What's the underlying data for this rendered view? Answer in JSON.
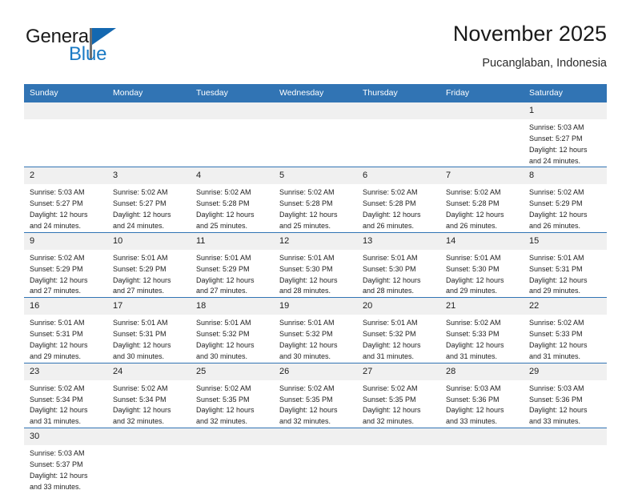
{
  "brand": {
    "name_part1": "General",
    "name_part2": "Blue",
    "logo_icon": "flag-triangle-icon",
    "accent_color": "#1a7ac4"
  },
  "header": {
    "title": "November 2025",
    "subtitle": "Pucanglaban, Indonesia"
  },
  "colors": {
    "header_blue": "#3174b4",
    "daynum_band": "#f0f0f0",
    "row_rule": "#3174b4",
    "text": "#1d1d1d"
  },
  "weekdays": [
    "Sunday",
    "Monday",
    "Tuesday",
    "Wednesday",
    "Thursday",
    "Friday",
    "Saturday"
  ],
  "weeks": [
    [
      {
        "day": "",
        "blank": true,
        "sunrise": "",
        "sunset": "",
        "daylight_line1": "",
        "daylight_line2": ""
      },
      {
        "day": "",
        "blank": true,
        "sunrise": "",
        "sunset": "",
        "daylight_line1": "",
        "daylight_line2": ""
      },
      {
        "day": "",
        "blank": true,
        "sunrise": "",
        "sunset": "",
        "daylight_line1": "",
        "daylight_line2": ""
      },
      {
        "day": "",
        "blank": true,
        "sunrise": "",
        "sunset": "",
        "daylight_line1": "",
        "daylight_line2": ""
      },
      {
        "day": "",
        "blank": true,
        "sunrise": "",
        "sunset": "",
        "daylight_line1": "",
        "daylight_line2": ""
      },
      {
        "day": "",
        "blank": true,
        "sunrise": "",
        "sunset": "",
        "daylight_line1": "",
        "daylight_line2": ""
      },
      {
        "day": "1",
        "blank": false,
        "sunrise": "Sunrise: 5:03 AM",
        "sunset": "Sunset: 5:27 PM",
        "daylight_line1": "Daylight: 12 hours",
        "daylight_line2": "and 24 minutes."
      }
    ],
    [
      {
        "day": "2",
        "blank": false,
        "sunrise": "Sunrise: 5:03 AM",
        "sunset": "Sunset: 5:27 PM",
        "daylight_line1": "Daylight: 12 hours",
        "daylight_line2": "and 24 minutes."
      },
      {
        "day": "3",
        "blank": false,
        "sunrise": "Sunrise: 5:02 AM",
        "sunset": "Sunset: 5:27 PM",
        "daylight_line1": "Daylight: 12 hours",
        "daylight_line2": "and 24 minutes."
      },
      {
        "day": "4",
        "blank": false,
        "sunrise": "Sunrise: 5:02 AM",
        "sunset": "Sunset: 5:28 PM",
        "daylight_line1": "Daylight: 12 hours",
        "daylight_line2": "and 25 minutes."
      },
      {
        "day": "5",
        "blank": false,
        "sunrise": "Sunrise: 5:02 AM",
        "sunset": "Sunset: 5:28 PM",
        "daylight_line1": "Daylight: 12 hours",
        "daylight_line2": "and 25 minutes."
      },
      {
        "day": "6",
        "blank": false,
        "sunrise": "Sunrise: 5:02 AM",
        "sunset": "Sunset: 5:28 PM",
        "daylight_line1": "Daylight: 12 hours",
        "daylight_line2": "and 26 minutes."
      },
      {
        "day": "7",
        "blank": false,
        "sunrise": "Sunrise: 5:02 AM",
        "sunset": "Sunset: 5:28 PM",
        "daylight_line1": "Daylight: 12 hours",
        "daylight_line2": "and 26 minutes."
      },
      {
        "day": "8",
        "blank": false,
        "sunrise": "Sunrise: 5:02 AM",
        "sunset": "Sunset: 5:29 PM",
        "daylight_line1": "Daylight: 12 hours",
        "daylight_line2": "and 26 minutes."
      }
    ],
    [
      {
        "day": "9",
        "blank": false,
        "sunrise": "Sunrise: 5:02 AM",
        "sunset": "Sunset: 5:29 PM",
        "daylight_line1": "Daylight: 12 hours",
        "daylight_line2": "and 27 minutes."
      },
      {
        "day": "10",
        "blank": false,
        "sunrise": "Sunrise: 5:01 AM",
        "sunset": "Sunset: 5:29 PM",
        "daylight_line1": "Daylight: 12 hours",
        "daylight_line2": "and 27 minutes."
      },
      {
        "day": "11",
        "blank": false,
        "sunrise": "Sunrise: 5:01 AM",
        "sunset": "Sunset: 5:29 PM",
        "daylight_line1": "Daylight: 12 hours",
        "daylight_line2": "and 27 minutes."
      },
      {
        "day": "12",
        "blank": false,
        "sunrise": "Sunrise: 5:01 AM",
        "sunset": "Sunset: 5:30 PM",
        "daylight_line1": "Daylight: 12 hours",
        "daylight_line2": "and 28 minutes."
      },
      {
        "day": "13",
        "blank": false,
        "sunrise": "Sunrise: 5:01 AM",
        "sunset": "Sunset: 5:30 PM",
        "daylight_line1": "Daylight: 12 hours",
        "daylight_line2": "and 28 minutes."
      },
      {
        "day": "14",
        "blank": false,
        "sunrise": "Sunrise: 5:01 AM",
        "sunset": "Sunset: 5:30 PM",
        "daylight_line1": "Daylight: 12 hours",
        "daylight_line2": "and 29 minutes."
      },
      {
        "day": "15",
        "blank": false,
        "sunrise": "Sunrise: 5:01 AM",
        "sunset": "Sunset: 5:31 PM",
        "daylight_line1": "Daylight: 12 hours",
        "daylight_line2": "and 29 minutes."
      }
    ],
    [
      {
        "day": "16",
        "blank": false,
        "sunrise": "Sunrise: 5:01 AM",
        "sunset": "Sunset: 5:31 PM",
        "daylight_line1": "Daylight: 12 hours",
        "daylight_line2": "and 29 minutes."
      },
      {
        "day": "17",
        "blank": false,
        "sunrise": "Sunrise: 5:01 AM",
        "sunset": "Sunset: 5:31 PM",
        "daylight_line1": "Daylight: 12 hours",
        "daylight_line2": "and 30 minutes."
      },
      {
        "day": "18",
        "blank": false,
        "sunrise": "Sunrise: 5:01 AM",
        "sunset": "Sunset: 5:32 PM",
        "daylight_line1": "Daylight: 12 hours",
        "daylight_line2": "and 30 minutes."
      },
      {
        "day": "19",
        "blank": false,
        "sunrise": "Sunrise: 5:01 AM",
        "sunset": "Sunset: 5:32 PM",
        "daylight_line1": "Daylight: 12 hours",
        "daylight_line2": "and 30 minutes."
      },
      {
        "day": "20",
        "blank": false,
        "sunrise": "Sunrise: 5:01 AM",
        "sunset": "Sunset: 5:32 PM",
        "daylight_line1": "Daylight: 12 hours",
        "daylight_line2": "and 31 minutes."
      },
      {
        "day": "21",
        "blank": false,
        "sunrise": "Sunrise: 5:02 AM",
        "sunset": "Sunset: 5:33 PM",
        "daylight_line1": "Daylight: 12 hours",
        "daylight_line2": "and 31 minutes."
      },
      {
        "day": "22",
        "blank": false,
        "sunrise": "Sunrise: 5:02 AM",
        "sunset": "Sunset: 5:33 PM",
        "daylight_line1": "Daylight: 12 hours",
        "daylight_line2": "and 31 minutes."
      }
    ],
    [
      {
        "day": "23",
        "blank": false,
        "sunrise": "Sunrise: 5:02 AM",
        "sunset": "Sunset: 5:34 PM",
        "daylight_line1": "Daylight: 12 hours",
        "daylight_line2": "and 31 minutes."
      },
      {
        "day": "24",
        "blank": false,
        "sunrise": "Sunrise: 5:02 AM",
        "sunset": "Sunset: 5:34 PM",
        "daylight_line1": "Daylight: 12 hours",
        "daylight_line2": "and 32 minutes."
      },
      {
        "day": "25",
        "blank": false,
        "sunrise": "Sunrise: 5:02 AM",
        "sunset": "Sunset: 5:35 PM",
        "daylight_line1": "Daylight: 12 hours",
        "daylight_line2": "and 32 minutes."
      },
      {
        "day": "26",
        "blank": false,
        "sunrise": "Sunrise: 5:02 AM",
        "sunset": "Sunset: 5:35 PM",
        "daylight_line1": "Daylight: 12 hours",
        "daylight_line2": "and 32 minutes."
      },
      {
        "day": "27",
        "blank": false,
        "sunrise": "Sunrise: 5:02 AM",
        "sunset": "Sunset: 5:35 PM",
        "daylight_line1": "Daylight: 12 hours",
        "daylight_line2": "and 32 minutes."
      },
      {
        "day": "28",
        "blank": false,
        "sunrise": "Sunrise: 5:03 AM",
        "sunset": "Sunset: 5:36 PM",
        "daylight_line1": "Daylight: 12 hours",
        "daylight_line2": "and 33 minutes."
      },
      {
        "day": "29",
        "blank": false,
        "sunrise": "Sunrise: 5:03 AM",
        "sunset": "Sunset: 5:36 PM",
        "daylight_line1": "Daylight: 12 hours",
        "daylight_line2": "and 33 minutes."
      }
    ],
    [
      {
        "day": "30",
        "blank": false,
        "sunrise": "Sunrise: 5:03 AM",
        "sunset": "Sunset: 5:37 PM",
        "daylight_line1": "Daylight: 12 hours",
        "daylight_line2": "and 33 minutes."
      },
      {
        "day": "",
        "blank": true,
        "sunrise": "",
        "sunset": "",
        "daylight_line1": "",
        "daylight_line2": ""
      },
      {
        "day": "",
        "blank": true,
        "sunrise": "",
        "sunset": "",
        "daylight_line1": "",
        "daylight_line2": ""
      },
      {
        "day": "",
        "blank": true,
        "sunrise": "",
        "sunset": "",
        "daylight_line1": "",
        "daylight_line2": ""
      },
      {
        "day": "",
        "blank": true,
        "sunrise": "",
        "sunset": "",
        "daylight_line1": "",
        "daylight_line2": ""
      },
      {
        "day": "",
        "blank": true,
        "sunrise": "",
        "sunset": "",
        "daylight_line1": "",
        "daylight_line2": ""
      },
      {
        "day": "",
        "blank": true,
        "sunrise": "",
        "sunset": "",
        "daylight_line1": "",
        "daylight_line2": ""
      }
    ]
  ]
}
